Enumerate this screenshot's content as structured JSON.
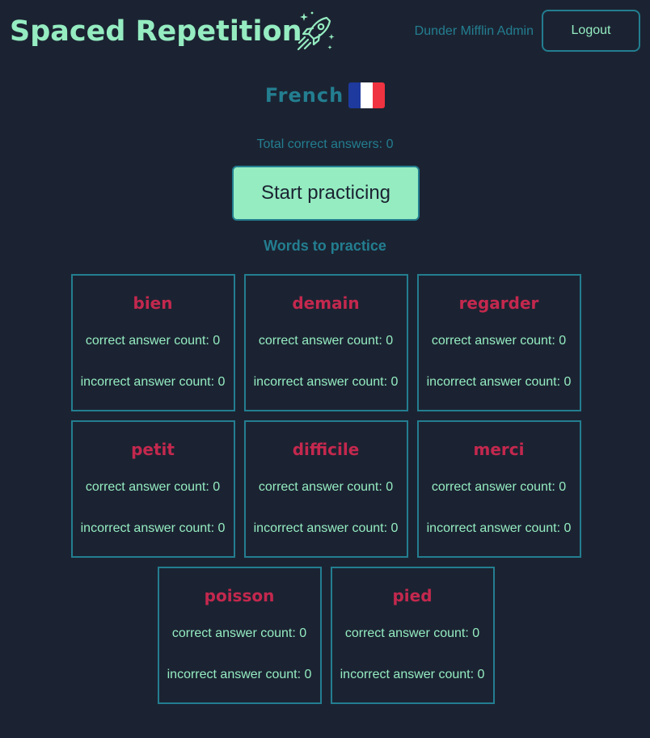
{
  "header": {
    "title": "Spaced Repetition",
    "logo_icon": "rocket-icon",
    "username": "Dunder Mifflin Admin",
    "logout_label": "Logout"
  },
  "language": {
    "name": "French",
    "flag_icon": "france-flag-icon",
    "flag_colors": [
      "#1e3a9e",
      "#ffffff",
      "#ef3340"
    ]
  },
  "total_correct": "Total correct answers: 0",
  "start_button_label": "Start practicing",
  "words_heading": "Words to practice",
  "colors": {
    "background": "#1b2332",
    "accent": "#95ecc1",
    "teal": "#237e90",
    "word": "#c4284e"
  },
  "words": [
    {
      "word": "bien",
      "correct": "correct answer count: 0",
      "incorrect": "incorrect answer count: 0"
    },
    {
      "word": "demain",
      "correct": "correct answer count: 0",
      "incorrect": "incorrect answer count: 0"
    },
    {
      "word": "regarder",
      "correct": "correct answer count: 0",
      "incorrect": "incorrect answer count: 0"
    },
    {
      "word": "petit",
      "correct": "correct answer count: 0",
      "incorrect": "incorrect answer count: 0"
    },
    {
      "word": "difficile",
      "correct": "correct answer count: 0",
      "incorrect": "incorrect answer count: 0"
    },
    {
      "word": "merci",
      "correct": "correct answer count: 0",
      "incorrect": "incorrect answer count: 0"
    },
    {
      "word": "poisson",
      "correct": "correct answer count: 0",
      "incorrect": "incorrect answer count: 0"
    },
    {
      "word": "pied",
      "correct": "correct answer count: 0",
      "incorrect": "incorrect answer count: 0"
    }
  ]
}
